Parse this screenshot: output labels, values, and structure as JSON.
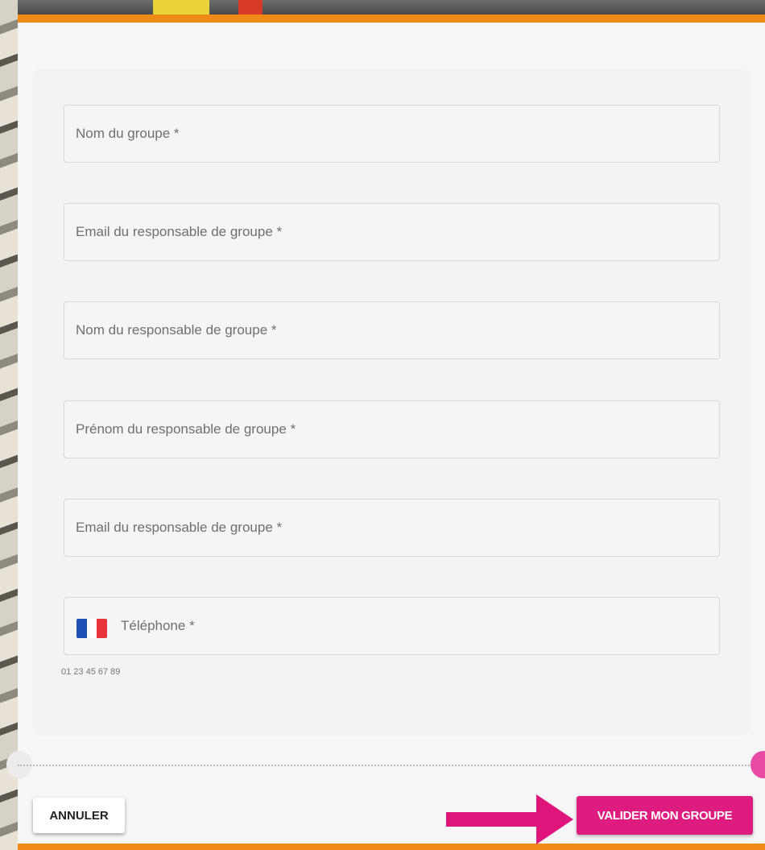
{
  "form": {
    "fields": [
      {
        "placeholder": "Nom du groupe *",
        "value": ""
      },
      {
        "placeholder": "Email du responsable de groupe *",
        "value": ""
      },
      {
        "placeholder": "Nom du responsable de groupe *",
        "value": ""
      },
      {
        "placeholder": "Prénom du responsable de groupe *",
        "value": ""
      },
      {
        "placeholder": "Email du responsable de groupe *",
        "value": ""
      }
    ],
    "phone": {
      "placeholder": "Téléphone *",
      "value": "",
      "hint": "01 23 45 67 89",
      "flag_icon": "france-flag-icon"
    }
  },
  "footer": {
    "cancel_label": "ANNULER",
    "submit_label": "VALIDER MON GROUPE",
    "arrow_icon": "arrow-right-icon"
  },
  "colors": {
    "accent_orange": "#f08a16",
    "primary_pink": "#de1c7f",
    "arrow_pink": "#e0157c"
  }
}
